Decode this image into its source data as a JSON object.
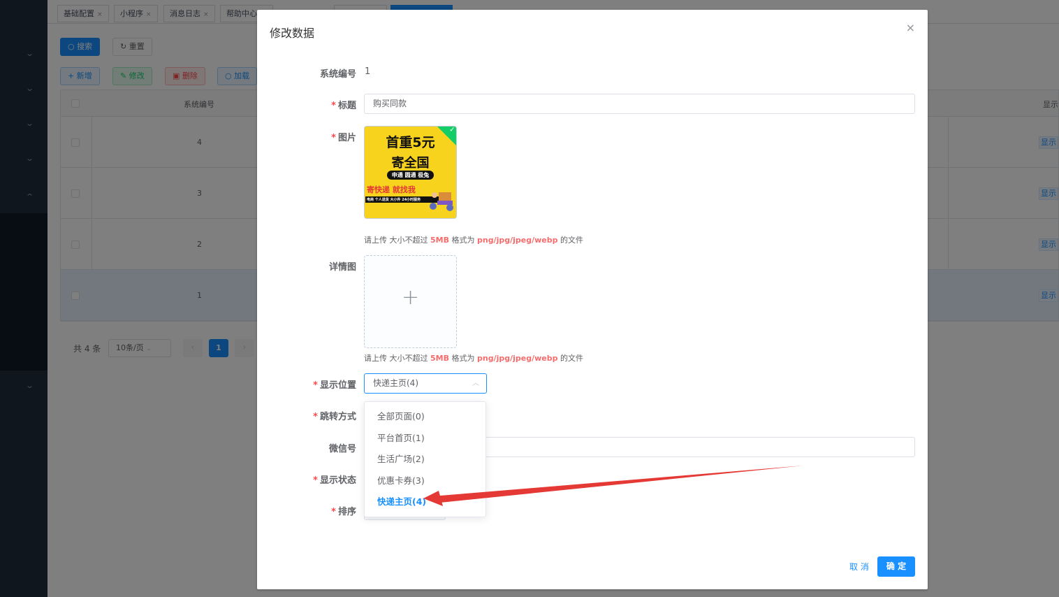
{
  "tabs": [
    {
      "label": "基础配置"
    },
    {
      "label": "小程序"
    },
    {
      "label": "消息日志"
    },
    {
      "label": "帮助中心"
    }
  ],
  "toolbar": {
    "search_label": "搜索",
    "reset_label": "重置",
    "add_label": "新增",
    "edit_label": "修改",
    "delete_label": "删除",
    "load_label": "加载"
  },
  "table": {
    "headers": {
      "id": "系统编号",
      "show": "显示"
    },
    "rows": [
      {
        "id": "4",
        "show": "显示"
      },
      {
        "id": "3",
        "show": "显示"
      },
      {
        "id": "2",
        "show": "显示"
      },
      {
        "id": "1",
        "show": "显示"
      }
    ]
  },
  "pagination": {
    "total": "共 4 条",
    "page_size": "10条/页",
    "current_page": "1"
  },
  "dialog": {
    "title": "修改数据",
    "close_glyph": "×",
    "fields": {
      "id_label": "系统编号",
      "id_value": "1",
      "title_label": "标题",
      "title_value": "购买同款",
      "image_label": "图片",
      "detail_label": "详情图",
      "position_label": "显示位置",
      "position_value": "快递主页(4)",
      "jump_label": "跳转方式",
      "wechat_label": "微信号",
      "status_label": "显示状态",
      "sort_label": "排序"
    },
    "upload_tip": {
      "prefix": "请上传 大小不超过",
      "size": "5MB",
      "mid": "格式为",
      "formats": "png/jpg/jpeg/webp",
      "suffix": "的文件"
    },
    "poster": {
      "line1": "首重5元",
      "line2": "寄全国",
      "line3": "申通 圆通 极兔",
      "line4": "寄快递 就找我",
      "line5": "电商 个人退货 大小件 24小时服务"
    },
    "dropdown_options": [
      {
        "label": "全部页面(0)"
      },
      {
        "label": "平台首页(1)"
      },
      {
        "label": "生活广场(2)"
      },
      {
        "label": "优惠卡券(3)"
      },
      {
        "label": "快递主页(4)"
      }
    ],
    "cancel_label": "取 消",
    "ok_label": "确 定"
  },
  "colors": {
    "primary": "#1890ff",
    "danger": "#f56c6c",
    "success": "#13ce66",
    "annotation_arrow": "#e53935"
  },
  "icons": [
    "search-icon",
    "refresh-icon",
    "plus-icon",
    "edit-icon",
    "delete-icon",
    "close-icon",
    "chevron-up-icon",
    "check-icon"
  ]
}
